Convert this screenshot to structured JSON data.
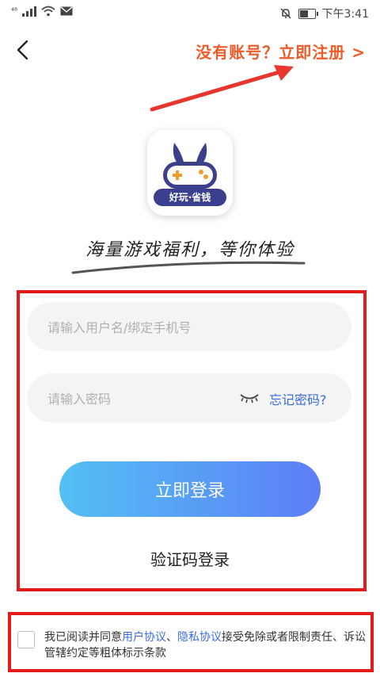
{
  "status_bar": {
    "network_label": "⁴⁶",
    "time": "下午3:41",
    "icons": [
      "signal-icon",
      "wifi-icon",
      "mail-icon",
      "mute-icon",
      "battery-icon"
    ]
  },
  "header": {
    "back_icon": "chevron-left-icon",
    "register_link": "没有账号？立即注册 >",
    "annotation_arrow_color": "#e8352e"
  },
  "brand": {
    "badge_text": "好玩·省钱",
    "slogan": "海量游戏福利，等你体验",
    "logo_color": "#3c3e8e",
    "accent_color": "#f39c2c"
  },
  "form": {
    "username_placeholder": "请输入用户名/绑定手机号",
    "password_placeholder": "请输入密码",
    "forgot_password": "忘记密码?",
    "eye_icon": "eye-closed-icon",
    "login_button": "立即登录",
    "code_login": "验证码登录"
  },
  "agreement": {
    "prefix": "我已阅读并同意",
    "user_agreement": "用户协议",
    "separator": "、",
    "privacy_agreement": "隐私协议",
    "suffix": "接受免除或者限制责任、诉讼管辖约定等粗体标示条款"
  },
  "colors": {
    "highlight_border": "#e21b1b",
    "register_text": "#ee5a28",
    "link": "#3c6cde",
    "button_gradient_start": "#53c0f4",
    "button_gradient_end": "#5d7ef6"
  }
}
